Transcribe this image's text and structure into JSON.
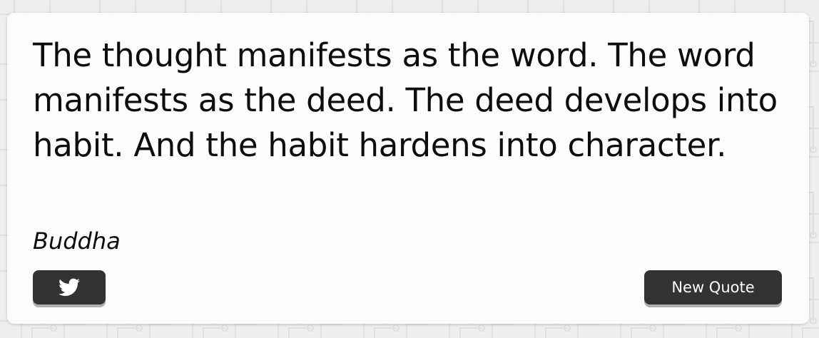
{
  "quote": {
    "text": "The thought manifests as the word. The word manifests as the deed. The deed develops into habit. And the habit hardens into character.",
    "author": "Buddha"
  },
  "buttons": {
    "tweet_icon": "twitter-icon",
    "new_quote_label": "New Quote"
  },
  "colors": {
    "background": "#eeeeee",
    "card": "#ffffff",
    "button": "#333333",
    "button_text": "#ffffff",
    "text": "#0d0d0d"
  }
}
